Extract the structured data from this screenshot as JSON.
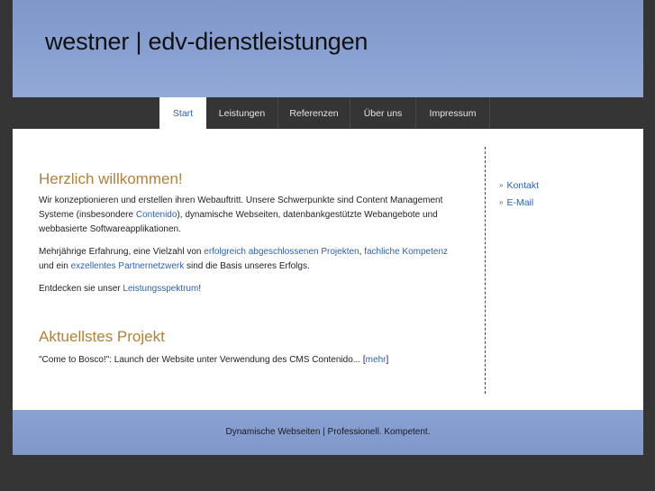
{
  "header": {
    "title": "westner | edv-dienstleistungen"
  },
  "nav": {
    "items": [
      {
        "label": "Start"
      },
      {
        "label": "Leistungen"
      },
      {
        "label": "Referenzen"
      },
      {
        "label": "Über uns"
      },
      {
        "label": "Impressum"
      }
    ],
    "active_index": 0
  },
  "main": {
    "welcome_heading": "Herzlich willkommen!",
    "p1": {
      "text_a": "Wir konzeptionieren und erstellen ihren Webauftritt. Unsere Schwerpunkte sind Content Management Systeme (insbesondere ",
      "link_contenido": "Contenido",
      "text_b": "), dynamische Webseiten, datenbankgestützte Webangebote und webbasierte Softwareapplikationen."
    },
    "p2": {
      "text_a": "Mehrjährige Erfahrung, eine Vielzahl von ",
      "link_projekte": "erfolgreich abgeschlossenen Projekten",
      "text_b": ", ",
      "link_kompetenz": "fachliche Kompetenz",
      "text_c": " und ein ",
      "link_partner": "exzellentes Partnernetzwerk",
      "text_d": " sind die Basis unseres Erfolgs."
    },
    "p3": {
      "text_a": "Entdecken sie unser ",
      "link_spektrum": "Leistungsspektrum",
      "text_b": "!"
    },
    "project_heading": "Aktuellstes Projekt",
    "project": {
      "text_a": "\"Come to Bosco!\": Launch der Website unter Verwendung des CMS Contenido... [",
      "link_mehr": "mehr",
      "text_b": "]"
    }
  },
  "sidebar": {
    "items": [
      {
        "label": "Kontakt"
      },
      {
        "label": "E-Mail"
      }
    ],
    "arrow_glyph": "»"
  },
  "footer": {
    "text": "Dynamische Webseiten | Professionell. Kompetent."
  }
}
